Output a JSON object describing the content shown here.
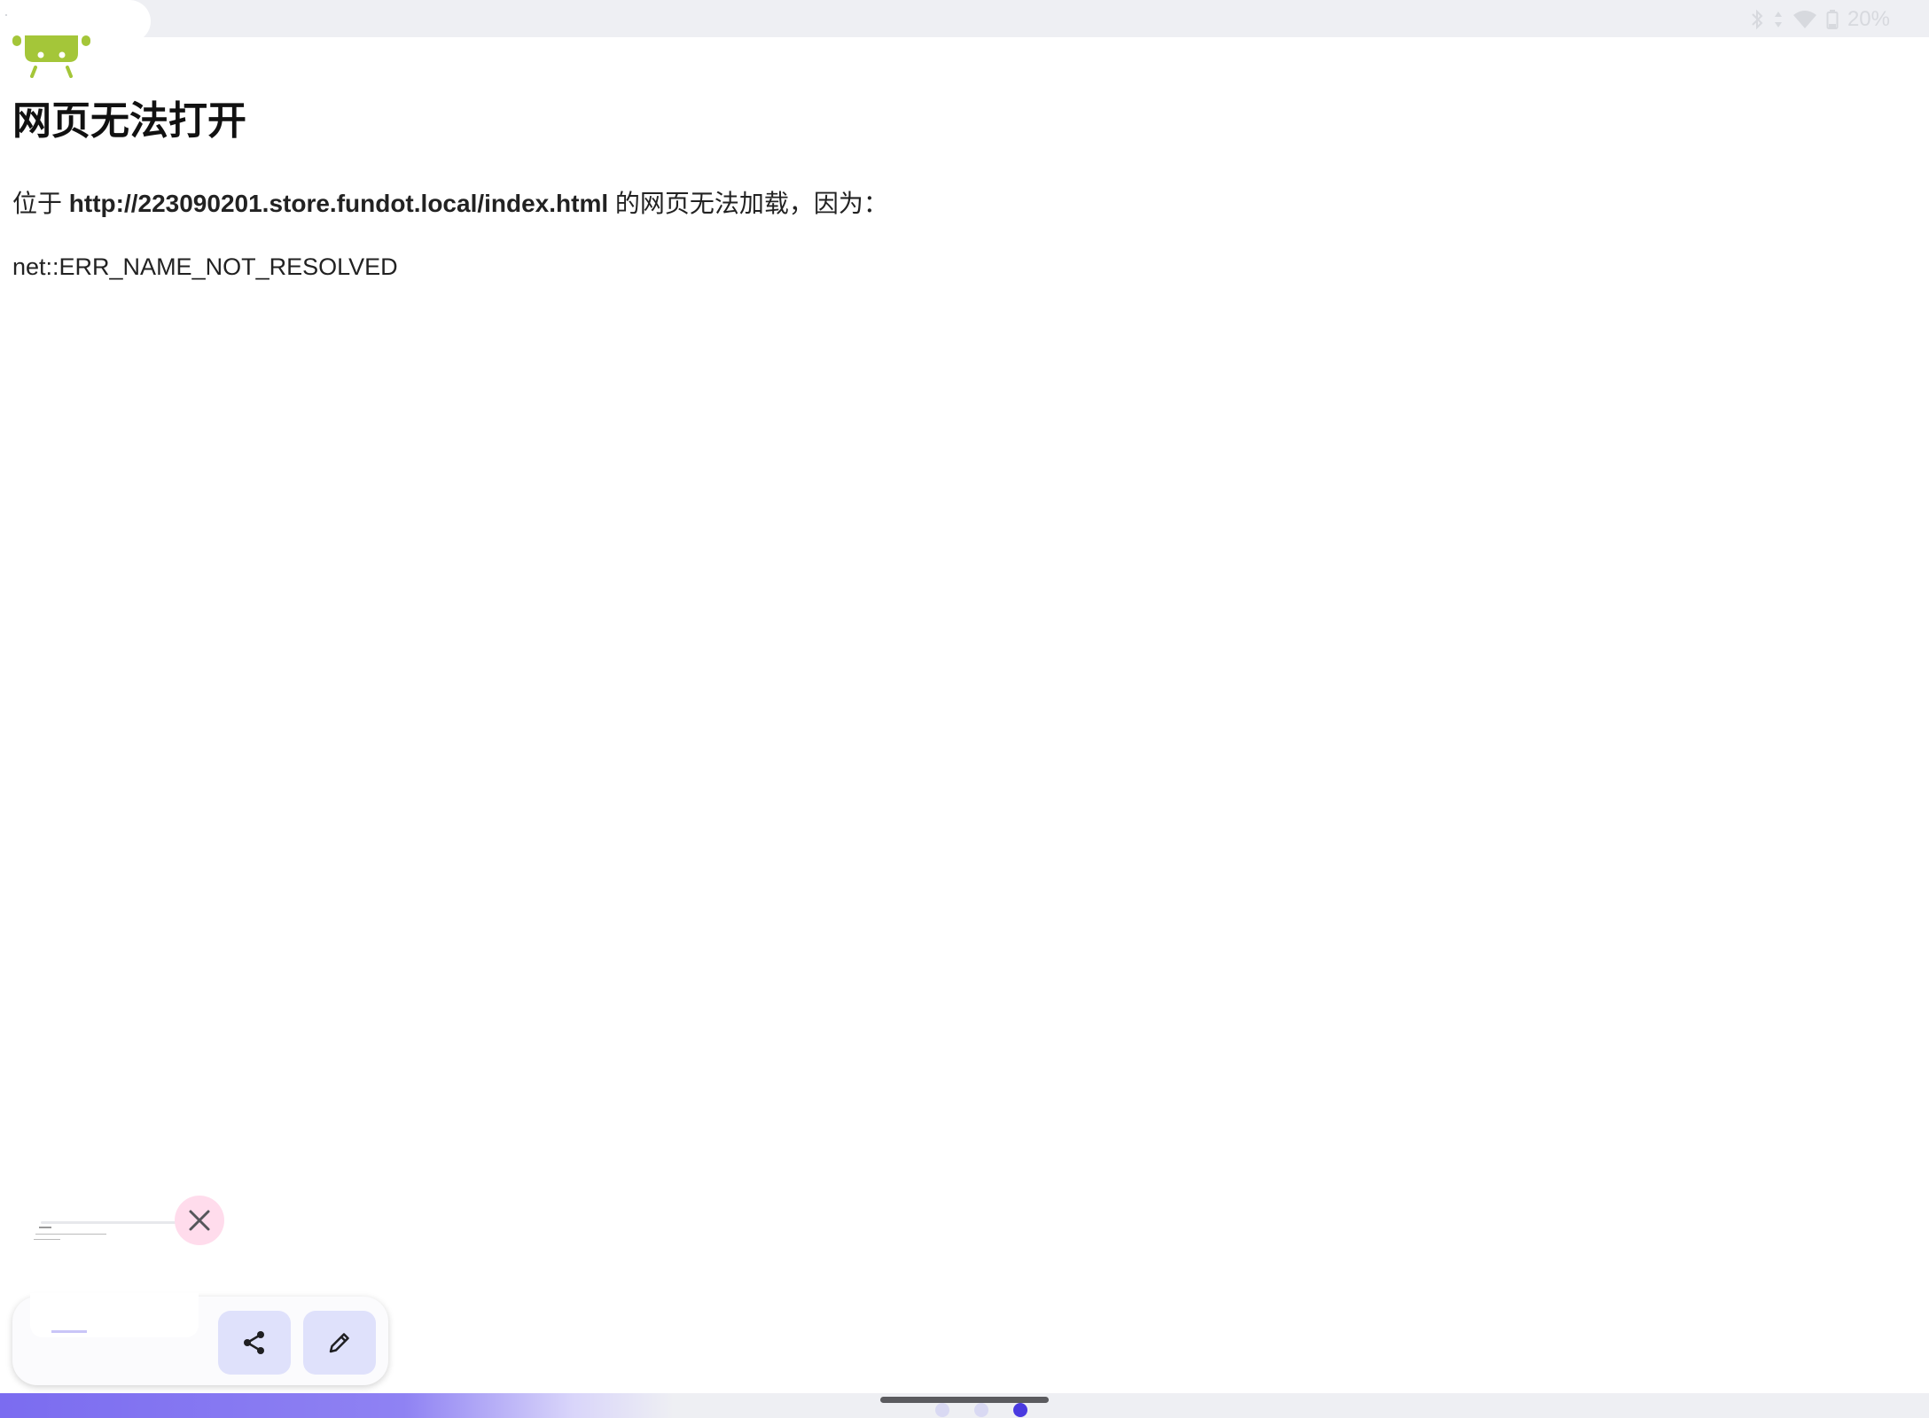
{
  "status_bar": {
    "battery": "20%",
    "icons": [
      "bluetooth-icon",
      "data-arrows-icon",
      "wifi-icon",
      "battery-icon"
    ]
  },
  "error_page": {
    "title": "网页无法打开",
    "desc_prefix": "位于 ",
    "url": "http://223090201.store.fundot.local/index.html",
    "desc_suffix": " 的网页无法加载，因为：",
    "error_code": "net::ERR_NAME_NOT_RESOLVED"
  },
  "screenshot_preview": {
    "icons": [
      "close-icon",
      "share-icon",
      "edit-icon"
    ]
  },
  "navigation": {
    "page_count": 3,
    "active_page": 3
  },
  "colors": {
    "accent": "#4a3ae0",
    "action_button_bg": "#dfe1fb",
    "close_button_bg": "#ffdcec",
    "android_green": "#a4c639",
    "status_bar_bg": "#eeeff3"
  }
}
